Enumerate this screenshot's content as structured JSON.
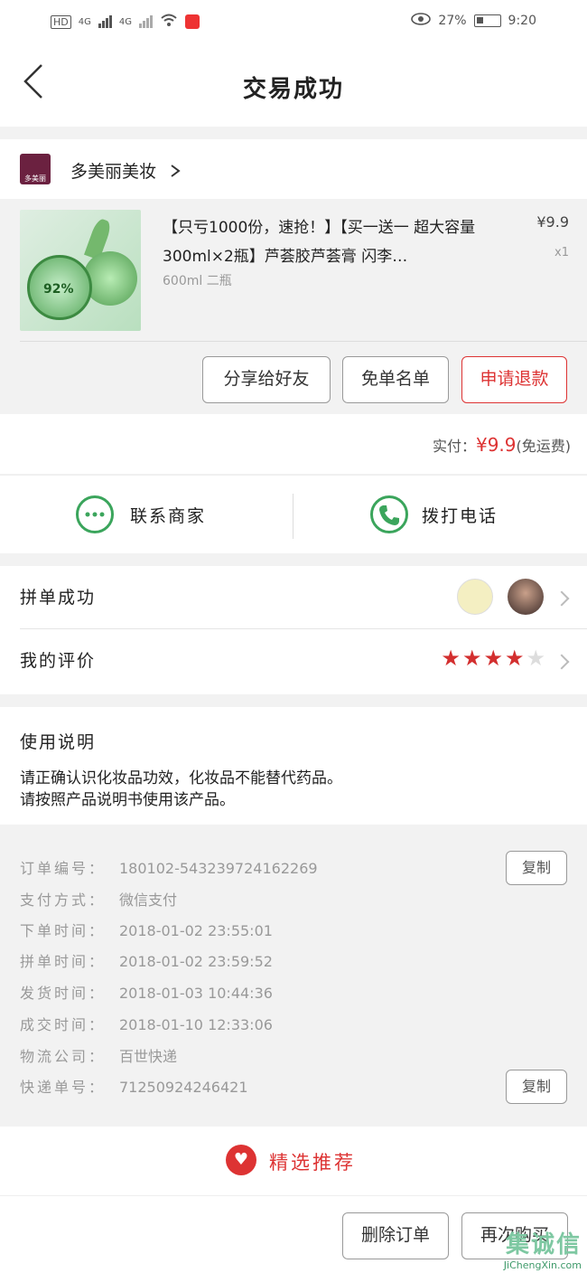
{
  "status_bar": {
    "hd": "HD",
    "net1": "4G",
    "net2": "4G",
    "battery_pct": "27%",
    "time": "9:20"
  },
  "header": {
    "title": "交易成功"
  },
  "shop": {
    "logo_text": "多美丽",
    "name": "多美丽美妆"
  },
  "product": {
    "title": "【只亏1000份，速抢！】【买一送一 超大容量300ml×2瓶】芦荟胶芦荟膏 闪李…",
    "spec": "600ml 二瓶",
    "price": "¥9.9",
    "qty": "x1",
    "image_text": "92%"
  },
  "actions": {
    "share": "分享给好友",
    "free_list": "免单名单",
    "refund": "申请退款"
  },
  "payment": {
    "label": "实付：",
    "amount": "¥9.9",
    "note": "(免运费)"
  },
  "contact": {
    "merchant": "联系商家",
    "call": "拨打电话"
  },
  "group": {
    "pin_label": "拼单成功",
    "review_label": "我的评价",
    "rating": 4,
    "rating_max": 5
  },
  "usage": {
    "title": "使用说明",
    "line1": "请正确认识化妆品功效，化妆品不能替代药品。",
    "line2": "请按照产品说明书使用该产品。"
  },
  "order_info": {
    "rows": [
      {
        "key": "订单编号：",
        "value": "180102-543239724162269"
      },
      {
        "key": "支付方式：",
        "value": "微信支付"
      },
      {
        "key": "下单时间：",
        "value": "2018-01-02 23:55:01"
      },
      {
        "key": "拼单时间：",
        "value": "2018-01-02 23:59:52"
      },
      {
        "key": "发货时间：",
        "value": "2018-01-03 10:44:36"
      },
      {
        "key": "成交时间：",
        "value": "2018-01-10 12:33:06"
      },
      {
        "key": "物流公司：",
        "value": "百世快递"
      },
      {
        "key": "快递单号：",
        "value": "71250924246421"
      }
    ],
    "copy_label": "复制"
  },
  "recommend": {
    "label": "精选推荐"
  },
  "footer": {
    "delete": "删除订单",
    "rebuy": "再次购买"
  },
  "watermark": {
    "big": "集诚信",
    "small": "JiChengXin.com"
  },
  "colors": {
    "accent": "#dd3333",
    "green": "#3ba55c",
    "star": "#d32f2f"
  }
}
